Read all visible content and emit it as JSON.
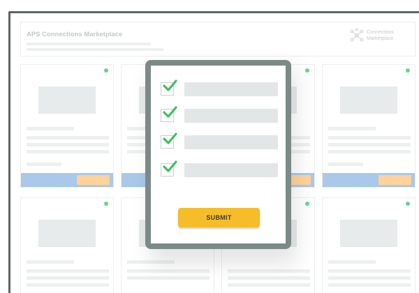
{
  "header": {
    "title": "APS Connections Marketplace",
    "logo_icon": "network-nodes-icon",
    "logo_line1": "Connections",
    "logo_line2": "Marketplace"
  },
  "colors": {
    "frame": "#5f6466",
    "modal_border": "#7b8a87",
    "check_green": "#3fbf63",
    "submit_bg": "#f6bd2a",
    "card_bar": "#a9c8ea",
    "card_button": "#ffd39a",
    "status_dot": "#6ad48a"
  },
  "modal": {
    "checklist_icon": "checkmark-icon",
    "checked_count": 4,
    "submit_label": "SUBMIT"
  }
}
